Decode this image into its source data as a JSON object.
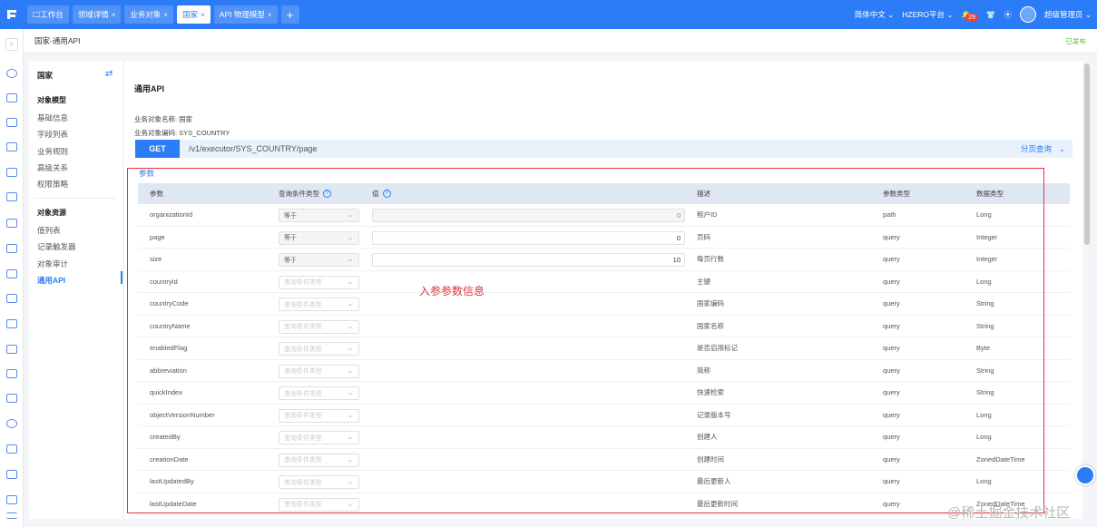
{
  "tabs": [
    {
      "label": "工作台",
      "closable": false,
      "active": false
    },
    {
      "label": "领域详情",
      "closable": true,
      "active": false
    },
    {
      "label": "业务对象",
      "closable": true,
      "active": false
    },
    {
      "label": "国家",
      "closable": true,
      "active": true
    },
    {
      "label": "API 物理模型",
      "closable": true,
      "active": false
    }
  ],
  "tab_add": "+",
  "tab_close": "×",
  "header": {
    "language": "简体中文",
    "platform": "HZERO平台",
    "notif_count": "29",
    "user": "超级管理员"
  },
  "breadcrumb": {
    "text": "国家-通用API",
    "status": "已发布"
  },
  "leftnav": {
    "title": "国家",
    "section1": "对象模型",
    "items1": [
      "基础信息",
      "字段列表",
      "业务规则",
      "高级关系",
      "权限策略"
    ],
    "section2": "对象资源",
    "items2": [
      "值列表",
      "记录触发器",
      "对象审计",
      "通用API"
    ]
  },
  "main": {
    "title": "通用API",
    "obj_name": "业务对象名称: 国家",
    "obj_code": "业务对象编码: SYS_COUNTRY",
    "method": "GET",
    "path": "/v1/executor/SYS_COUNTRY/page",
    "mode": "分页查询",
    "params_label": "参数"
  },
  "table": {
    "headers": [
      "参数",
      "查询条件类型",
      "值",
      "描述",
      "参数类型",
      "数据类型"
    ],
    "rows": [
      {
        "name": "organizationId",
        "cond": "等于",
        "cond_filled": true,
        "value": "0",
        "value_disabled": true,
        "has_input": true,
        "desc": "租户ID",
        "ptype": "path",
        "dtype": "Long"
      },
      {
        "name": "page",
        "cond": "等于",
        "cond_filled": true,
        "value": "0",
        "value_disabled": false,
        "has_input": true,
        "desc": "页码",
        "ptype": "query",
        "dtype": "Integer"
      },
      {
        "name": "size",
        "cond": "等于",
        "cond_filled": true,
        "value": "10",
        "value_disabled": false,
        "has_input": true,
        "desc": "每页行数",
        "ptype": "query",
        "dtype": "Integer"
      },
      {
        "name": "countryId",
        "cond": "查询条件类型",
        "cond_filled": false,
        "value": "",
        "has_input": false,
        "desc": "主键",
        "ptype": "query",
        "dtype": "Long"
      },
      {
        "name": "countryCode",
        "cond": "查询条件类型",
        "cond_filled": false,
        "value": "",
        "has_input": false,
        "desc": "国家编码",
        "ptype": "query",
        "dtype": "String"
      },
      {
        "name": "countryName",
        "cond": "查询条件类型",
        "cond_filled": false,
        "value": "",
        "has_input": false,
        "desc": "国家名称",
        "ptype": "query",
        "dtype": "String"
      },
      {
        "name": "enabledFlag",
        "cond": "查询条件类型",
        "cond_filled": false,
        "value": "",
        "has_input": false,
        "desc": "是否启用标记",
        "ptype": "query",
        "dtype": "Byte"
      },
      {
        "name": "abbreviation",
        "cond": "查询条件类型",
        "cond_filled": false,
        "value": "",
        "has_input": false,
        "desc": "简称",
        "ptype": "query",
        "dtype": "String"
      },
      {
        "name": "quickIndex",
        "cond": "查询条件类型",
        "cond_filled": false,
        "value": "",
        "has_input": false,
        "desc": "快速检索",
        "ptype": "query",
        "dtype": "String"
      },
      {
        "name": "objectVersionNumber",
        "cond": "查询条件类型",
        "cond_filled": false,
        "value": "",
        "has_input": false,
        "desc": "记录版本号",
        "ptype": "query",
        "dtype": "Long"
      },
      {
        "name": "createdBy",
        "cond": "查询条件类型",
        "cond_filled": false,
        "value": "",
        "has_input": false,
        "desc": "创建人",
        "ptype": "query",
        "dtype": "Long"
      },
      {
        "name": "creationDate",
        "cond": "查询条件类型",
        "cond_filled": false,
        "value": "",
        "has_input": false,
        "desc": "创建时间",
        "ptype": "query",
        "dtype": "ZonedDateTime"
      },
      {
        "name": "lastUpdatedBy",
        "cond": "查询条件类型",
        "cond_filled": false,
        "value": "",
        "has_input": false,
        "desc": "最后更新人",
        "ptype": "query",
        "dtype": "Long"
      },
      {
        "name": "lastUpdateDate",
        "cond": "查询条件类型",
        "cond_filled": false,
        "value": "",
        "has_input": false,
        "desc": "最后更新时间",
        "ptype": "query",
        "dtype": "ZonedDateTime"
      }
    ]
  },
  "annotation": "入参参数信息",
  "watermark": "@稀土掘金技术社区",
  "colors": {
    "primary": "#2b7cf6",
    "annotation": "#e5323a",
    "published": "#52c41a"
  },
  "icons": {
    "logo": "hzero-logo-icon",
    "sync": "sync-icon",
    "help": "help-circle-icon",
    "dropdown": "chevron-down-icon"
  }
}
